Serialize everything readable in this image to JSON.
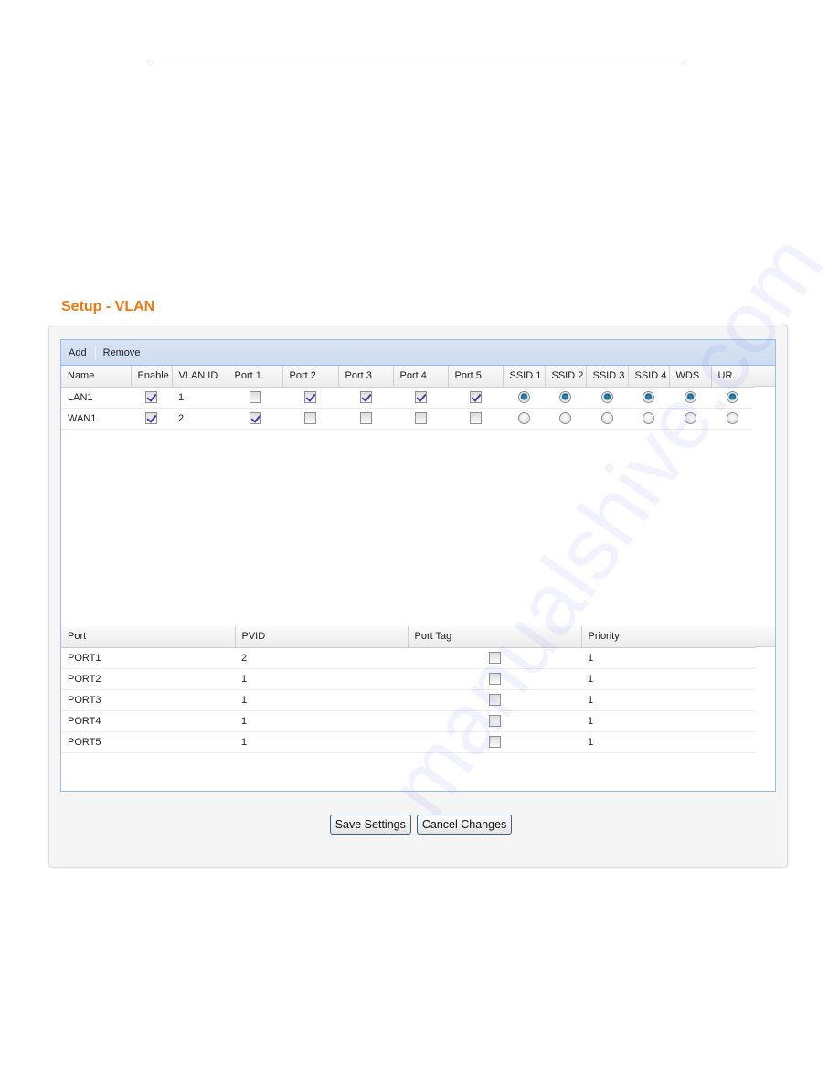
{
  "page": {
    "title": "Setup - VLAN"
  },
  "toolbar": {
    "add_label": "Add",
    "remove_label": "Remove"
  },
  "vlan_table": {
    "columns": [
      "Name",
      "Enable",
      "VLAN ID",
      "Port 1",
      "Port 2",
      "Port 3",
      "Port 4",
      "Port 5",
      "SSID 1",
      "SSID 2",
      "SSID 3",
      "SSID 4",
      "WDS",
      "UR"
    ],
    "rows": [
      {
        "name": "LAN1",
        "enable": true,
        "vlan_id": "1",
        "ports": [
          false,
          true,
          true,
          true,
          true
        ],
        "ssid_wds_ur": [
          true,
          true,
          true,
          true,
          true,
          true
        ]
      },
      {
        "name": "WAN1",
        "enable": true,
        "vlan_id": "2",
        "ports": [
          true,
          false,
          false,
          false,
          false
        ],
        "ssid_wds_ur": [
          false,
          false,
          false,
          false,
          false,
          false
        ]
      }
    ]
  },
  "port_table": {
    "columns": [
      "Port",
      "PVID",
      "Port Tag",
      "Priority"
    ],
    "rows": [
      {
        "port": "PORT1",
        "pvid": "2",
        "port_tag": false,
        "priority": "1"
      },
      {
        "port": "PORT2",
        "pvid": "1",
        "port_tag": false,
        "priority": "1"
      },
      {
        "port": "PORT3",
        "pvid": "1",
        "port_tag": false,
        "priority": "1"
      },
      {
        "port": "PORT4",
        "pvid": "1",
        "port_tag": false,
        "priority": "1"
      },
      {
        "port": "PORT5",
        "pvid": "1",
        "port_tag": false,
        "priority": "1"
      }
    ]
  },
  "buttons": {
    "save_label": "Save Settings",
    "cancel_label": "Cancel Changes"
  },
  "watermark": "manualshive.com",
  "colors": {
    "title_orange": "#f07a12",
    "grid_border": "#99bbe8",
    "toolbar_bg": "#d3e1f1"
  }
}
